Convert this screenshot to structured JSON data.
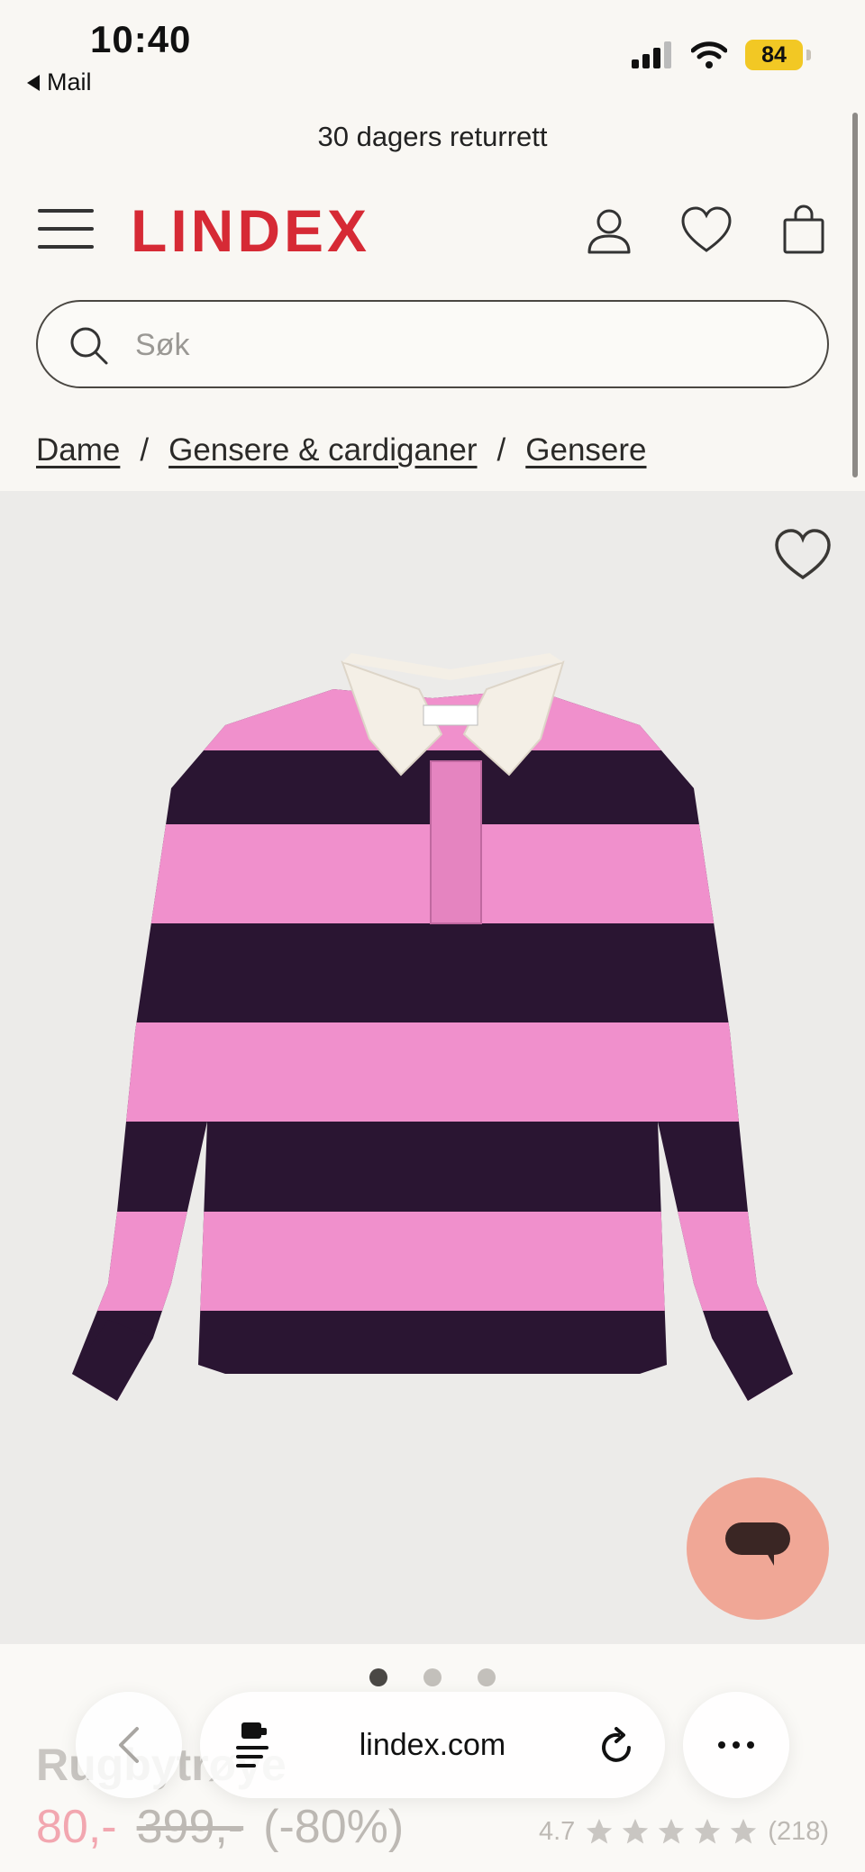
{
  "status_bar": {
    "time": "10:40",
    "back_app": "Mail",
    "battery": "84"
  },
  "promo": "30 dagers returrett",
  "header": {
    "logo": "LINDEX",
    "icons": [
      "menu-icon",
      "account-icon",
      "heart-icon",
      "bag-icon"
    ]
  },
  "search": {
    "placeholder": "Søk"
  },
  "breadcrumb": {
    "items": [
      "Dame",
      "Gensere & cardiganer",
      "Gensere"
    ],
    "separator": "/"
  },
  "product": {
    "name": "Rugbytrøye",
    "price_now": "80,-",
    "price_old": "399,-",
    "discount": "(-80%)",
    "rating": "4.7",
    "stars": 5,
    "review_count": "(218)",
    "image_count": 3,
    "active_image": 1,
    "colors": {
      "pink": "#f090cc",
      "navy": "#2a1532",
      "collar": "#f4efe6"
    }
  },
  "browser": {
    "url": "lindex.com"
  },
  "colors": {
    "brand": "#d62a35",
    "chat": "#f0a796"
  }
}
